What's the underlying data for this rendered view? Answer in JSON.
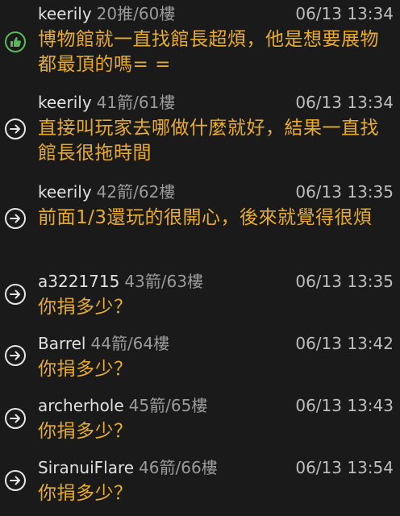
{
  "comments": [
    {
      "type": "push",
      "icon": "thumbs-up-icon",
      "author": "keerily",
      "floor": "20推/60樓",
      "time": "06/13 13:34",
      "content": "博物館就一直找館長超煩，他是想要展物都最頂的嗎= ="
    },
    {
      "type": "arrow",
      "icon": "arrow-right-icon",
      "author": "keerily",
      "floor": "41箭/61樓",
      "time": "06/13 13:34",
      "content": "直接叫玩家去哪做什麼就好，結果一直找館長很拖時間"
    },
    {
      "type": "arrow",
      "icon": "arrow-right-icon",
      "author": "keerily",
      "floor": "42箭/62樓",
      "time": "06/13 13:35",
      "content": "前面1/3還玩的很開心，後來就覺得很煩"
    },
    {
      "type": "arrow",
      "icon": "arrow-right-icon",
      "author": "a3221715",
      "floor": "43箭/63樓",
      "time": "06/13 13:35",
      "content": "你捐多少？"
    },
    {
      "type": "arrow",
      "icon": "arrow-right-icon",
      "author": "Barrel",
      "floor": "44箭/64樓",
      "time": "06/13 13:42",
      "content": "你捐多少？"
    },
    {
      "type": "arrow",
      "icon": "arrow-right-icon",
      "author": "archerhole",
      "floor": "45箭/65樓",
      "time": "06/13 13:43",
      "content": "你捐多少？"
    },
    {
      "type": "arrow",
      "icon": "arrow-right-icon",
      "author": "SiranuiFlare",
      "floor": "46箭/66樓",
      "time": "06/13 13:54",
      "content": "你捐多少？"
    }
  ],
  "colors": {
    "background": "#1a1a1a",
    "author": "#e0e0e0",
    "floor": "#9a9a9a",
    "time": "#bdbdbd",
    "content": "#e7ac2e",
    "push_icon": "#5cb85c",
    "arrow_icon": "#e6e6e6"
  }
}
